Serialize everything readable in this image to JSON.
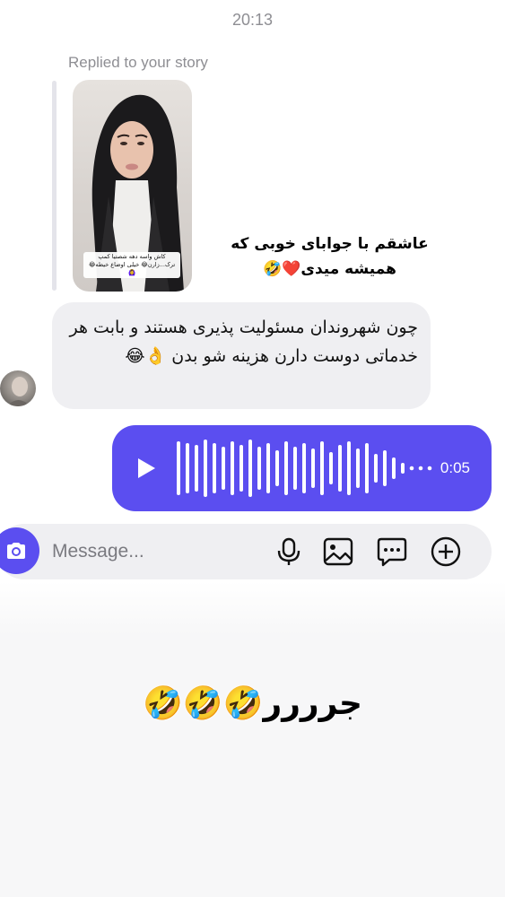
{
  "header": {
    "timestamp": "20:13"
  },
  "story_reply": {
    "label": "Replied to your story",
    "story_caption": "کاش واسه دهه شصتیا کمپ ترک...زارن😂 خیلی اوضاع خیطه😂🙆‍♀️",
    "reply_text": "عاشقم با جوابای خوبی که همیشه میدی❤️🤣"
  },
  "incoming_message": {
    "text": "چون شهروندان مسئولیت پذیری هستند و بابت هر خدماتی دوست دارن هزینه شو بدن 👌😂"
  },
  "voice_message": {
    "duration": "0:05"
  },
  "composer": {
    "placeholder": "Message...",
    "icons": [
      "camera-icon",
      "microphone-icon",
      "image-icon",
      "sticker-chat-icon",
      "plus-circle-icon"
    ]
  },
  "overlay": {
    "text": "جرررر🤣🤣🤣"
  },
  "colors": {
    "accent": "#5b4ef0",
    "bubble_gray": "#efeff2",
    "muted_text": "#8e8e93"
  }
}
